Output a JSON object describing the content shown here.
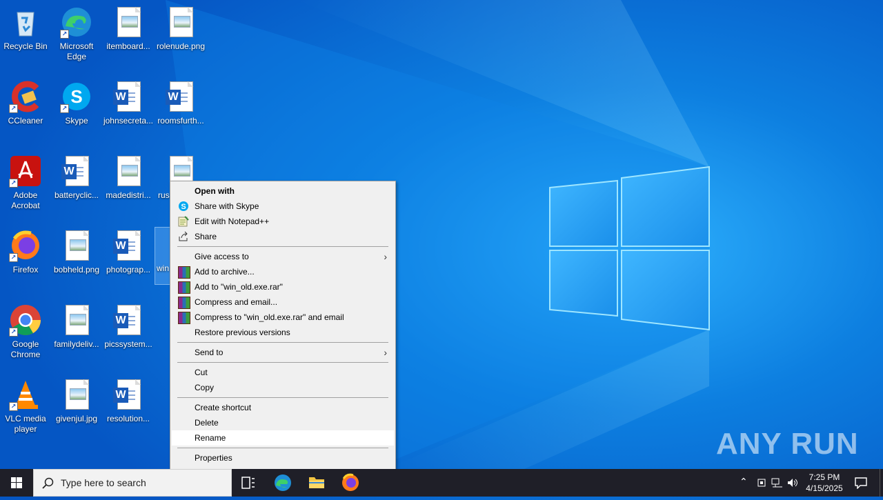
{
  "desktop": {
    "icons": [
      {
        "label": "Recycle Bin"
      },
      {
        "label": "Microsoft Edge"
      },
      {
        "label": "itemboard..."
      },
      {
        "label": "rolenude.png"
      },
      {
        "label": "CCleaner"
      },
      {
        "label": "Skype"
      },
      {
        "label": "johnsecreta..."
      },
      {
        "label": "roomsfurth..."
      },
      {
        "label": "Adobe Acrobat"
      },
      {
        "label": "batteryclic..."
      },
      {
        "label": "madedistri..."
      },
      {
        "label": "rus"
      },
      {
        "label": "Firefox"
      },
      {
        "label": "bobheld.png"
      },
      {
        "label": "photograp..."
      },
      {
        "label": "win"
      },
      {
        "label": "Google Chrome"
      },
      {
        "label": "familydeliv..."
      },
      {
        "label": "picssystem..."
      },
      {
        "label": "VLC media player"
      },
      {
        "label": "givenjul.jpg"
      },
      {
        "label": "resolution..."
      }
    ]
  },
  "context_menu": {
    "items": [
      {
        "label": "Open with"
      },
      {
        "label": "Share with Skype"
      },
      {
        "label": "Edit with Notepad++"
      },
      {
        "label": "Share"
      },
      {
        "label": "Give access to"
      },
      {
        "label": "Add to archive..."
      },
      {
        "label": "Add to \"win_old.exe.rar\""
      },
      {
        "label": "Compress and email..."
      },
      {
        "label": "Compress to \"win_old.exe.rar\" and email"
      },
      {
        "label": "Restore previous versions"
      },
      {
        "label": "Send to"
      },
      {
        "label": "Cut"
      },
      {
        "label": "Copy"
      },
      {
        "label": "Create shortcut"
      },
      {
        "label": "Delete"
      },
      {
        "label": "Rename"
      },
      {
        "label": "Properties"
      }
    ],
    "highlighted": "Rename"
  },
  "taskbar": {
    "search_placeholder": "Type here to search",
    "time": "7:25 PM",
    "date": "4/15/2025"
  },
  "watermark": "ANY RUN",
  "colors": {
    "accent": "#0a74da",
    "taskbar": "#1f1f28",
    "menu_bg": "#f0f0f0"
  }
}
